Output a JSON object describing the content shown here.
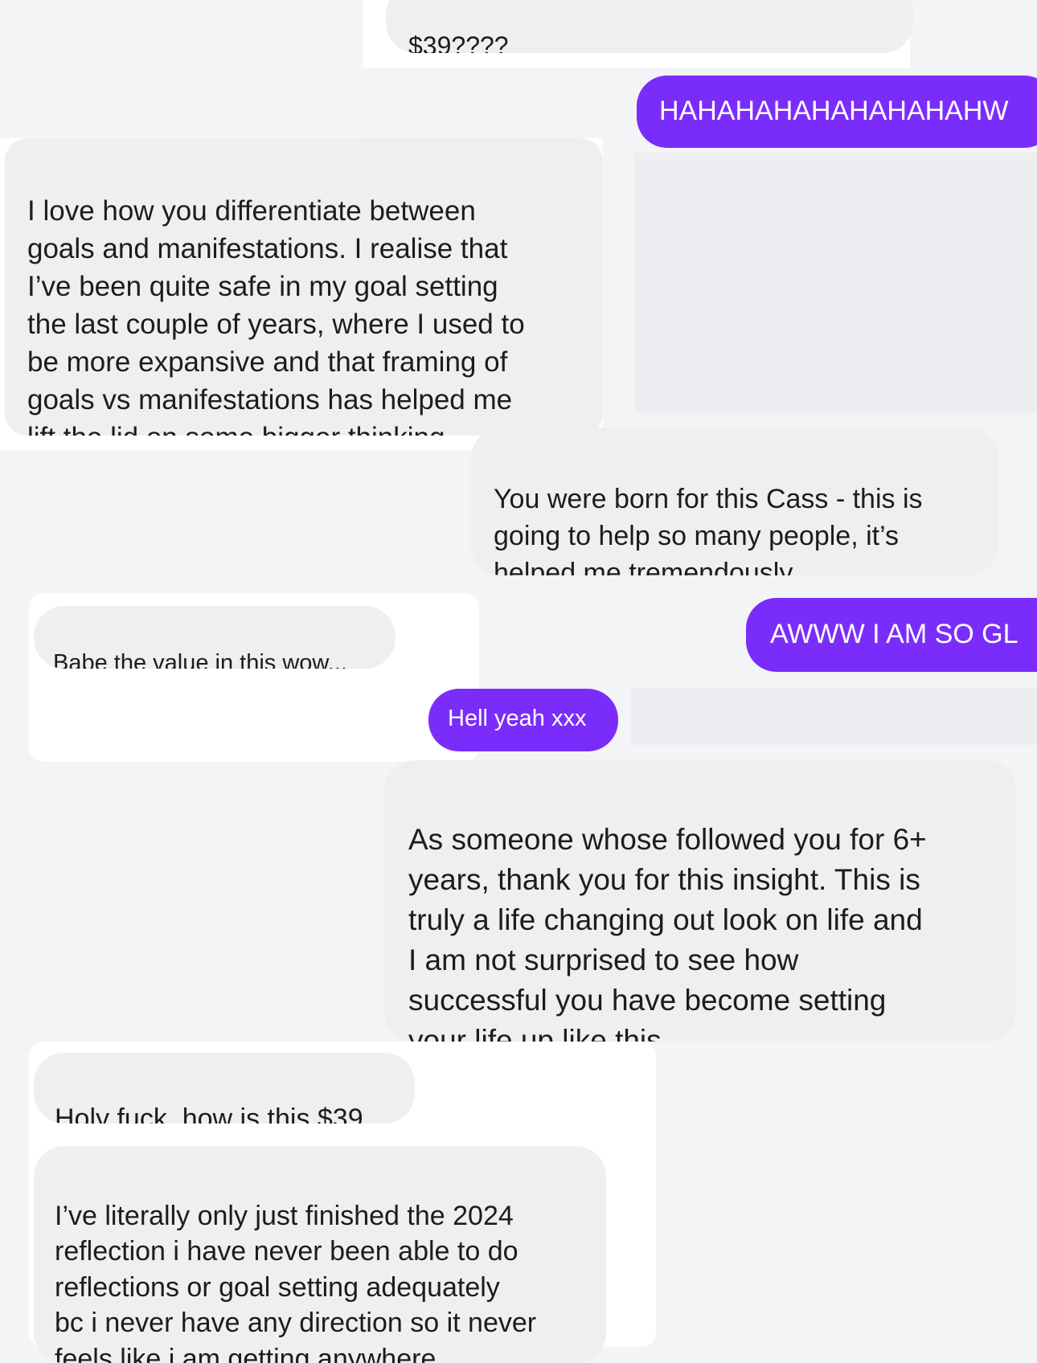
{
  "messages": [
    {
      "id": "m1",
      "direction": "incoming",
      "text": "$39????"
    },
    {
      "id": "m2",
      "direction": "outgoing",
      "text": "HAHAHAHAHAHAHAHAHW"
    },
    {
      "id": "m3",
      "direction": "incoming",
      "text": "I love how you differentiate between\ngoals and manifestations. I realise that\nI’ve been quite safe in my goal setting\nthe last couple of years, where I used to\nbe more expansive and that framing of\ngoals vs manifestations has helped me\nlift the lid on some bigger thinking"
    },
    {
      "id": "m4",
      "direction": "incoming",
      "text": "You were born for this Cass - this is\ngoing to help so many people, it’s\nhelped me tremendously",
      "emoji": "💕"
    },
    {
      "id": "m5",
      "direction": "incoming",
      "text": "Babe the value in this wow..."
    },
    {
      "id": "m6",
      "direction": "outgoing",
      "text": "AWWW I AM SO GL"
    },
    {
      "id": "m7",
      "direction": "outgoing",
      "text": "Hell yeah xxx"
    },
    {
      "id": "m8",
      "direction": "incoming",
      "text": "As someone whose followed you for 6+\nyears, thank you for this insight. This is\ntruly a life changing out look on life and\nI am not surprised to see how\nsuccessful you have become setting\nyour life up like this."
    },
    {
      "id": "m9",
      "direction": "incoming",
      "text": "Holy fuck, how is this $39"
    },
    {
      "id": "m10",
      "direction": "incoming",
      "text": "I’ve literally only just finished the 2024\nreflection i have never been able to do\nreflections or goal setting adequately\nbc i never have any direction so it never\nfeels like i am getting anywhere"
    }
  ],
  "colors": {
    "outgoing_bubble": "#7a2dfa",
    "incoming_bubble": "#efeff2",
    "background": "#f3f4f6"
  }
}
